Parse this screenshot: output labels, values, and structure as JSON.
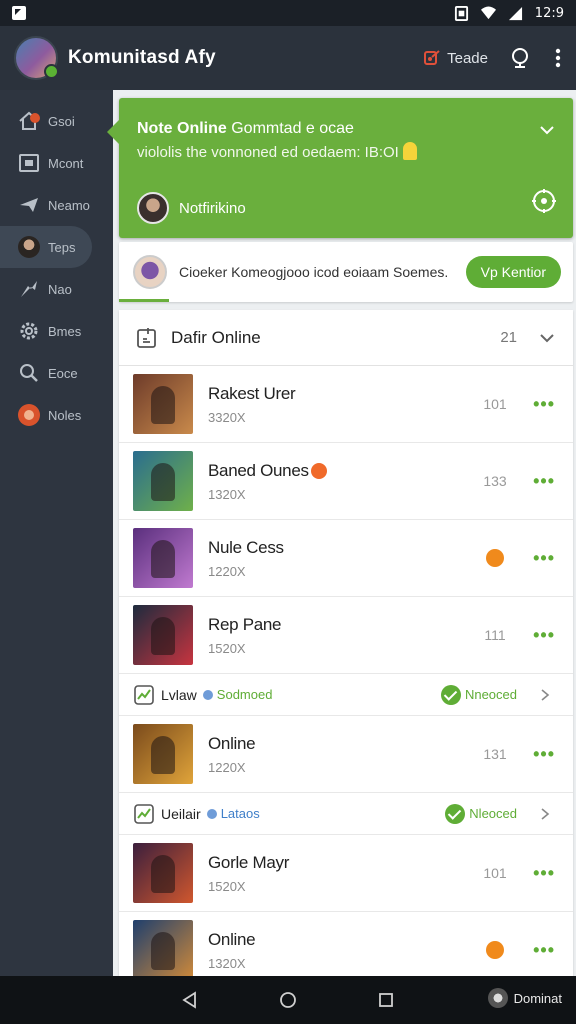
{
  "status_bar": {
    "time": "12:9"
  },
  "app": {
    "title": "Komunitasd Afy",
    "trade_label": "Teade"
  },
  "sidebar": {
    "items": [
      {
        "label": "Gsoi",
        "icon": "home-icon"
      },
      {
        "label": "Mcont",
        "icon": "message-icon"
      },
      {
        "label": "Neamo",
        "icon": "send-icon"
      },
      {
        "label": "Teps",
        "icon": "avatar"
      },
      {
        "label": "Nao",
        "icon": "arrow-icon"
      },
      {
        "label": "Bmes",
        "icon": "gear-icon"
      },
      {
        "label": "Eoce",
        "icon": "search-icon"
      },
      {
        "label": "Noles",
        "icon": "avatar-badge"
      }
    ]
  },
  "notification": {
    "title_bold": "Note Online",
    "title_rest": " Gommtad e ocae",
    "text": "viololis the vonnoned ed oedaem: IB:OI",
    "user": "Notfirikino"
  },
  "invite": {
    "text": "Cioeker Komeogjooo icod eoiaam Soemes.",
    "button": "Vp Kentior"
  },
  "list": {
    "title": "Dafir Online",
    "count": "21",
    "items": [
      {
        "type": "game",
        "name": "Rakest Urer",
        "sub": "3320X",
        "value": "101",
        "thumb": [
          "#6d3b2a",
          "#c98a4b"
        ]
      },
      {
        "type": "game",
        "name": "Baned Ounes",
        "sub": "1320X",
        "value": "133",
        "thumb": [
          "#2a6d8f",
          "#6fb04a"
        ],
        "dot": true
      },
      {
        "type": "game",
        "name": "Nule Cess",
        "sub": "1220X",
        "value": "",
        "thumb": [
          "#5a2f7d",
          "#c07ad0"
        ],
        "mid_dot": true
      },
      {
        "type": "game",
        "name": "Rep Pane",
        "sub": "1520X",
        "value": "111",
        "thumb": [
          "#1d2b3e",
          "#c7343f"
        ]
      },
      {
        "type": "status",
        "label": "Lvlaw",
        "value": "Sodmoed",
        "value_color": "green",
        "confirm": "Nneoced"
      },
      {
        "type": "game",
        "name": "Online",
        "sub": "1220X",
        "value": "131",
        "thumb": [
          "#7a4a1c",
          "#e0a43a"
        ]
      },
      {
        "type": "status",
        "label": "Ueilair",
        "value": "Lataos",
        "value_color": "blue",
        "confirm": "Nleoced"
      },
      {
        "type": "game",
        "name": "Gorle Mayr",
        "sub": "1520X",
        "value": "101",
        "thumb": [
          "#3b1f3d",
          "#d0572e"
        ]
      },
      {
        "type": "game",
        "name": "Online",
        "sub": "1320X",
        "value": "",
        "thumb": [
          "#1f3f6d",
          "#d08a3a"
        ],
        "mid_dot": true
      }
    ]
  },
  "nav_bar": {
    "app_label": "Dominat"
  },
  "colors": {
    "accent_green": "#6aaf3d",
    "sidebar_bg": "#2e3540",
    "orange": "#f08a1c"
  }
}
